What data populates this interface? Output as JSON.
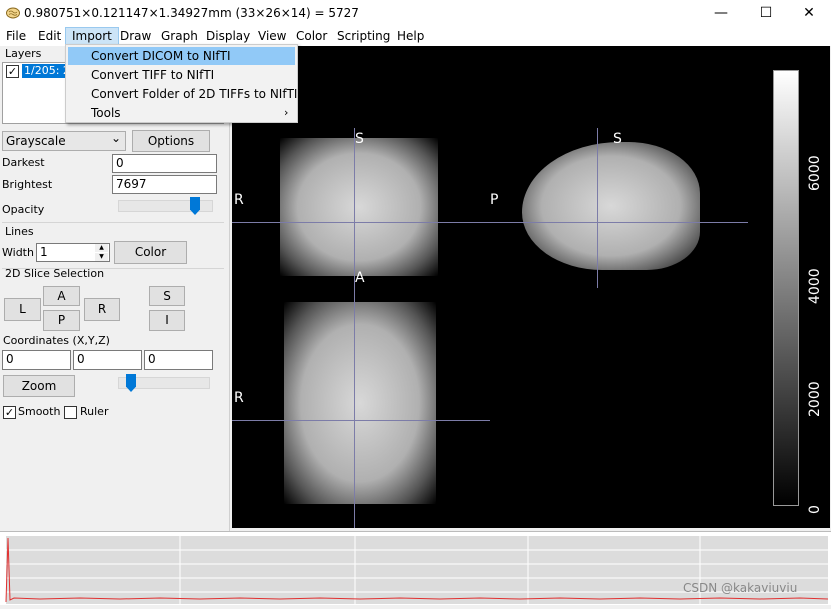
{
  "window": {
    "title": "0.980751×0.121147×1.34927mm (33×26×14) =  5727",
    "minimize_glyph": "—",
    "maximize_glyph": "☐",
    "close_glyph": "✕"
  },
  "menu": {
    "file": "File",
    "edit": "Edit",
    "import": "Import",
    "draw": "Draw",
    "graph": "Graph",
    "display": "Display",
    "view": "View",
    "color": "Color",
    "scripting": "Scripting",
    "help": "Help"
  },
  "import_menu": {
    "item1": "Convert DICOM to NIfTI",
    "item2": "Convert TIFF to NIfTI",
    "item3": "Convert Folder of 2D TIFFs to NIfTI",
    "item4": "Tools",
    "submenu_arrow": "›"
  },
  "layers": {
    "title": "Layers",
    "item_checked": "✓",
    "item_label": "1/205: 2"
  },
  "display": {
    "colormap": "Grayscale",
    "dropdown_arrow": "⌄",
    "options_label": "Options",
    "darkest_label": "Darkest",
    "darkest_value": "0",
    "brightest_label": "Brightest",
    "brightest_value": "7697",
    "opacity_label": "Opacity",
    "opacity_level": 0.85
  },
  "lines": {
    "title": "Lines",
    "width_label": "Width",
    "width_value": "1",
    "spin_up": "▲",
    "spin_down": "▼",
    "color_label": "Color"
  },
  "slice": {
    "title": "2D Slice Selection",
    "L": "L",
    "A": "A",
    "P": "P",
    "R": "R",
    "S": "S",
    "I": "I"
  },
  "coords": {
    "title": "Coordinates (X,Y,Z)",
    "x": "0",
    "y": "0",
    "z": "0"
  },
  "zoom": {
    "label": "Zoom",
    "level": 0.1
  },
  "options": {
    "smooth_checked": "✓",
    "smooth_label": "Smooth",
    "ruler_label": "Ruler"
  },
  "viewer": {
    "coronal_top": "S",
    "coronal_left": "R",
    "sagittal_top": "S",
    "sagittal_left": "P",
    "axial_top": "A",
    "axial_left": "R"
  },
  "colorbar": {
    "ticks": [
      "6000",
      "4000",
      "2000",
      "0"
    ],
    "values": [
      6000,
      4000,
      2000,
      0
    ],
    "max": 7697
  },
  "watermark": "CSDN @kakaviuviu",
  "colors": {
    "accent": "#0078d7",
    "menu_highlight": "#cce4f7",
    "graph_line": "#e03030",
    "crosshair": "#7c7ca8"
  }
}
